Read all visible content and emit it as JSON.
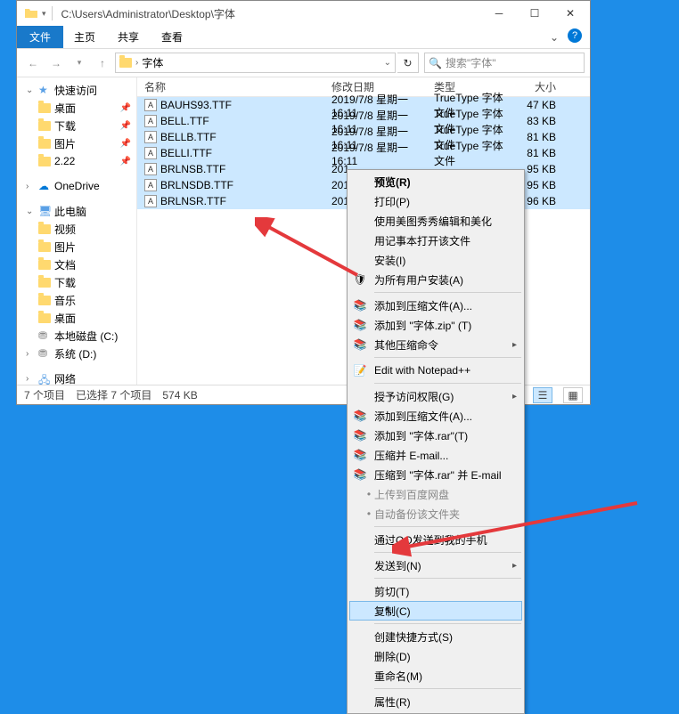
{
  "window": {
    "title_path": "C:\\Users\\Administrator\\Desktop\\字体"
  },
  "menubar": {
    "file": "文件",
    "tabs": [
      "主页",
      "共享",
      "查看"
    ]
  },
  "navbar": {
    "breadcrumb_text": "字体",
    "search_placeholder": "搜索\"字体\""
  },
  "sidebar": {
    "quick": "快速访问",
    "items_pinned": [
      "桌面",
      "下载",
      "图片",
      "2.22"
    ],
    "onedrive": "OneDrive",
    "thispc": "此电脑",
    "pc_items": [
      "视频",
      "图片",
      "文档",
      "下载",
      "音乐",
      "桌面",
      "本地磁盘 (C:)",
      "系统 (D:)"
    ],
    "network": "网络"
  },
  "columns": {
    "name": "名称",
    "date": "修改日期",
    "type": "类型",
    "size": "大小"
  },
  "files": [
    {
      "name": "BAUHS93.TTF",
      "date": "2019/7/8 星期一 16:11",
      "type": "TrueType 字体文件",
      "size": "47 KB"
    },
    {
      "name": "BELL.TTF",
      "date": "2019/7/8 星期一 16:11",
      "type": "TrueType 字体文件",
      "size": "83 KB"
    },
    {
      "name": "BELLB.TTF",
      "date": "2019/7/8 星期一 16:11",
      "type": "TrueType 字体文件",
      "size": "81 KB"
    },
    {
      "name": "BELLI.TTF",
      "date": "2019/7/8 星期一 16:11",
      "type": "TrueType 字体文件",
      "size": "81 KB"
    },
    {
      "name": "BRLNSB.TTF",
      "date": "201",
      "type": "",
      "size": "95 KB"
    },
    {
      "name": "BRLNSDB.TTF",
      "date": "201",
      "type": "",
      "size": "95 KB"
    },
    {
      "name": "BRLNSR.TTF",
      "date": "201",
      "type": "",
      "size": "96 KB"
    }
  ],
  "statusbar": {
    "count": "7 个项目",
    "selected": "已选择 7 个项目",
    "size": "574 KB"
  },
  "context_menu": {
    "items": [
      {
        "label": "预览(R)",
        "bold": true
      },
      {
        "label": "打印(P)"
      },
      {
        "label": "使用美图秀秀编辑和美化"
      },
      {
        "label": "用记事本打开该文件"
      },
      {
        "label": "安装(I)"
      },
      {
        "label": "为所有用户安装(A)",
        "icon": "shield"
      },
      {
        "sep": true
      },
      {
        "label": "添加到压缩文件(A)...",
        "icon": "rar"
      },
      {
        "label": "添加到 \"字体.zip\" (T)",
        "icon": "rar"
      },
      {
        "label": "其他压缩命令",
        "icon": "rar",
        "sub": true
      },
      {
        "sep": true
      },
      {
        "label": "Edit with Notepad++",
        "icon": "npp"
      },
      {
        "sep": true
      },
      {
        "label": "授予访问权限(G)",
        "sub": true
      },
      {
        "label": "添加到压缩文件(A)...",
        "icon": "winrar"
      },
      {
        "label": "添加到 \"字体.rar\"(T)",
        "icon": "winrar"
      },
      {
        "label": "压缩并 E-mail...",
        "icon": "winrar"
      },
      {
        "label": "压缩到 \"字体.rar\" 并 E-mail",
        "icon": "winrar"
      },
      {
        "label": "上传到百度网盘",
        "dim": true,
        "indent_dot": true
      },
      {
        "label": "自动备份该文件夹",
        "dim": true,
        "indent_dot": true
      },
      {
        "sep": true
      },
      {
        "label": "通过QQ发送到我的手机"
      },
      {
        "sep": true
      },
      {
        "label": "发送到(N)",
        "sub": true
      },
      {
        "sep": true
      },
      {
        "label": "剪切(T)"
      },
      {
        "label": "复制(C)",
        "hover": true,
        "cursor": true
      },
      {
        "sep": true
      },
      {
        "label": "创建快捷方式(S)"
      },
      {
        "label": "删除(D)"
      },
      {
        "label": "重命名(M)"
      },
      {
        "sep": true
      },
      {
        "label": "属性(R)"
      }
    ]
  }
}
